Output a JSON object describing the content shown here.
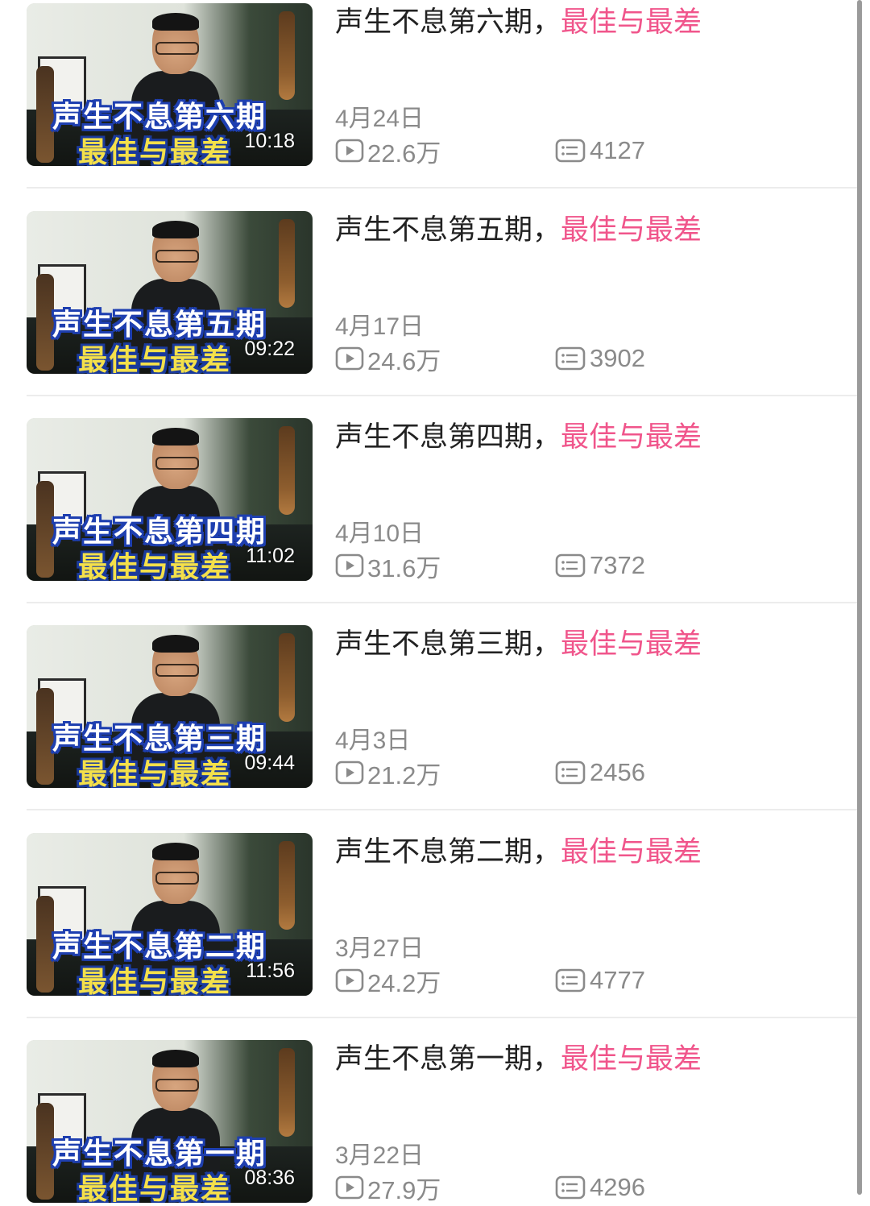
{
  "videos": [
    {
      "title_main": "声生不息第六期，",
      "title_highlight": "最佳与最差",
      "thumb_line1": "声生不息第六期",
      "thumb_line2": "最佳与最差",
      "duration": "10:18",
      "date": "4月24日",
      "views": "22.6万",
      "comments": "4127"
    },
    {
      "title_main": "声生不息第五期，",
      "title_highlight": "最佳与最差",
      "thumb_line1": "声生不息第五期",
      "thumb_line2": "最佳与最差",
      "duration": "09:22",
      "date": "4月17日",
      "views": "24.6万",
      "comments": "3902"
    },
    {
      "title_main": "声生不息第四期，",
      "title_highlight": "最佳与最差",
      "thumb_line1": "声生不息第四期",
      "thumb_line2": "最佳与最差",
      "duration": "11:02",
      "date": "4月10日",
      "views": "31.6万",
      "comments": "7372"
    },
    {
      "title_main": "声生不息第三期，",
      "title_highlight": "最佳与最差",
      "thumb_line1": "声生不息第三期",
      "thumb_line2": "最佳与最差",
      "duration": "09:44",
      "date": "4月3日",
      "views": "21.2万",
      "comments": "2456"
    },
    {
      "title_main": "声生不息第二期，",
      "title_highlight": "最佳与最差",
      "thumb_line1": "声生不息第二期",
      "thumb_line2": "最佳与最差",
      "duration": "11:56",
      "date": "3月27日",
      "views": "24.2万",
      "comments": "4777"
    },
    {
      "title_main": "声生不息第一期，",
      "title_highlight": "最佳与最差",
      "thumb_line1": "声生不息第一期",
      "thumb_line2": "最佳与最差",
      "duration": "08:36",
      "date": "3月22日",
      "views": "27.9万",
      "comments": "4296"
    }
  ],
  "icons": {
    "views": "play-icon",
    "comments": "comment-icon"
  },
  "colors": {
    "highlight": "#f0558b",
    "title": "#222222",
    "meta": "#8a8a8a"
  }
}
